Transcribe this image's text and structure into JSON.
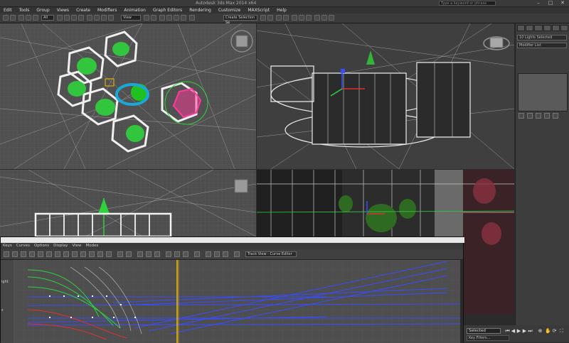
{
  "app": {
    "title": "Autodesk 3ds Max 2014 x64",
    "search_placeholder": "Type a keyword or phrase"
  },
  "window_buttons": [
    "–",
    "□",
    "✕"
  ],
  "menu": [
    "Edit",
    "Tools",
    "Group",
    "Views",
    "Create",
    "Modifiers",
    "Animation",
    "Graph Editors",
    "Rendering",
    "Customize",
    "MAXScript",
    "Help"
  ],
  "toolbar": {
    "selection_filter": "All",
    "view_dropdown": "View",
    "named_selection": "Create Selection Se"
  },
  "command_panel": {
    "modifier_field": "Modifier List",
    "name_field": "10 Lights Selected"
  },
  "track_view": {
    "menu": [
      "Keys",
      "Curves",
      "Options",
      "Display",
      "View",
      "Modes"
    ],
    "title_field": "Track View - Curve Editor",
    "tree_labels": [
      "ight",
      "s"
    ]
  },
  "status": {
    "selection": "Selected",
    "key_filter": "Key Filters..."
  },
  "colors": {
    "accent": "#f0c000",
    "curve_blue": "#3a4cff",
    "curve_green": "#2fd23c",
    "curve_red": "#e03030",
    "selected_pink": "#ff3a9a"
  }
}
